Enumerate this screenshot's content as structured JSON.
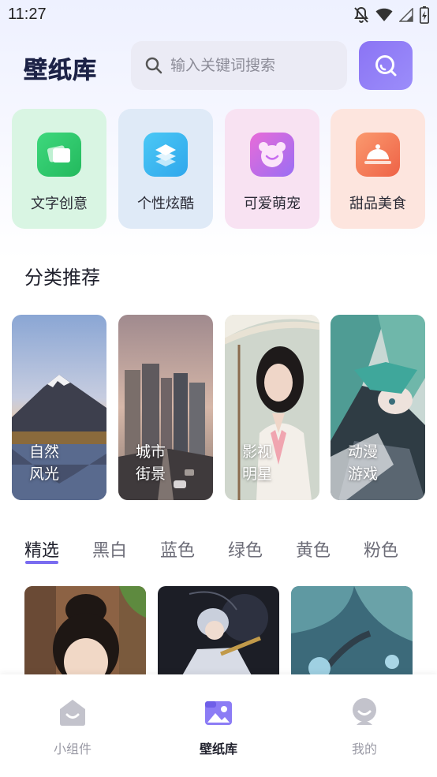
{
  "status": {
    "time": "11:27"
  },
  "header": {
    "logo": "壁纸库",
    "search_placeholder": "输入关键词搜索"
  },
  "quick_categories": [
    {
      "label": "文字创意",
      "bg": "#d9f5e3",
      "icon_bg": "#2ec86b",
      "icon": "cards-icon"
    },
    {
      "label": "个性炫酷",
      "bg": "#dfeaf7",
      "icon_bg": "#3ab8f0",
      "icon": "layers-icon"
    },
    {
      "label": "可爱萌宠",
      "bg": "#f8e2f2",
      "icon_bg": "#c76df0",
      "icon": "bear-face-icon"
    },
    {
      "label": "甜品美食",
      "bg": "#fde5de",
      "icon_bg": "#f47a5a",
      "icon": "cloche-icon"
    }
  ],
  "section": {
    "title": "分类推荐"
  },
  "category_cards": [
    {
      "line1": "自然",
      "line2": "风光"
    },
    {
      "line1": "城市",
      "line2": "街景"
    },
    {
      "line1": "影视",
      "line2": "明星"
    },
    {
      "line1": "动漫",
      "line2": "游戏"
    }
  ],
  "tabs": [
    "精选",
    "黑白",
    "蓝色",
    "绿色",
    "黄色",
    "粉色"
  ],
  "active_tab": "精选",
  "accent_color": "#7a6cf0",
  "bottom_nav": [
    {
      "label": "小组件",
      "active": false
    },
    {
      "label": "壁纸库",
      "active": true
    },
    {
      "label": "我的",
      "active": false
    }
  ]
}
